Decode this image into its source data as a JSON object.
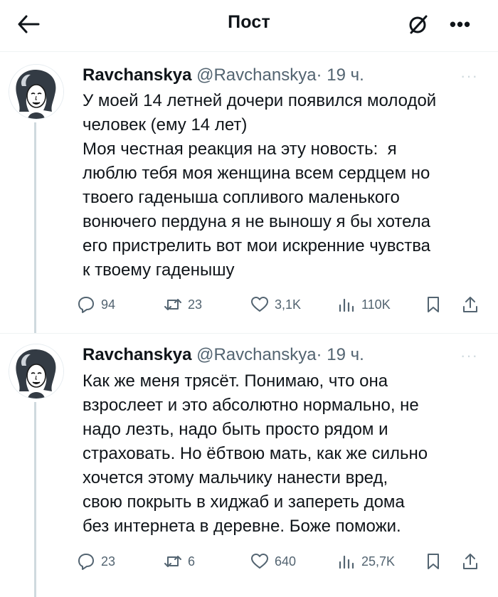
{
  "header": {
    "title": "Пост",
    "back_icon": "arrow-left-icon",
    "grok_icon": "grok-icon",
    "more": "•••"
  },
  "tweets": [
    {
      "name": "Ravchanskya",
      "handle": "@Ravchanskya",
      "dot": "·",
      "time": "19 ч.",
      "more": "···",
      "lines": [
        "У моей 14 летней дочери появился молодой",
        "человек (ему 14 лет)",
        "Моя честная реакция на эту новость:  я",
        "люблю тебя моя женщина всем сердцем но",
        "твоего гаденыша сопливого маленького",
        "вонючего пердуна я не выношу я бы хотела",
        "его пристрелить вот мои искренние чувства",
        "к твоему гаденышу"
      ],
      "stats": {
        "replies": "94",
        "reposts": "23",
        "likes": "3,1K",
        "views": "110K"
      }
    },
    {
      "name": "Ravchanskya",
      "handle": "@Ravchanskya",
      "dot": "·",
      "time": "19 ч.",
      "more": "···",
      "lines": [
        "Как же меня трясёт. Понимаю, что она",
        "взрослеет и это абсолютно нормально, не",
        "надо лезть, надо быть просто рядом и",
        "страховать. Но ёбтвою мать, как же сильно",
        "хочется этому мальчику нанести вред,",
        "свою покрыть в хиджаб и запереть дома",
        "без интернета в деревне. Боже поможи."
      ],
      "stats": {
        "replies": "23",
        "reposts": "6",
        "likes": "640",
        "views": "25,7K"
      }
    }
  ]
}
